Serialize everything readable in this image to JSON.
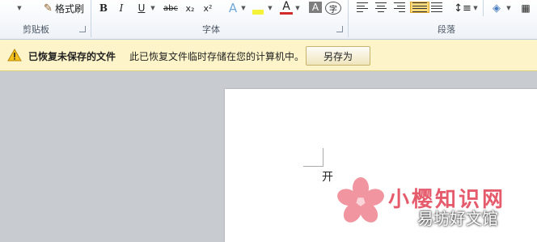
{
  "ribbon": {
    "format_painter_label": "格式刷",
    "groups": {
      "clipboard": "剪贴板",
      "font": "字体",
      "paragraph": "段落"
    },
    "font_buttons": {
      "bold": "B",
      "italic": "I",
      "underline": "U",
      "strikethrough": "abc",
      "subscript": "x₂",
      "superscript": "x²",
      "text_effect": "A",
      "font_color": "A",
      "char_shading": "A",
      "enclose": "字"
    }
  },
  "message_bar": {
    "title": "已恢复未保存的文件",
    "text": "此已恢复文件临时存储在您的计算机中。",
    "button": "另存为"
  },
  "document": {
    "text": "开"
  },
  "watermark": {
    "title": "小樱知识网",
    "subtitle": "易坊好文馆"
  },
  "colors": {
    "accent_highlight": "#fcd97a",
    "font_color_red": "#d22b2b",
    "watermark_pink": "#e55b6c"
  }
}
